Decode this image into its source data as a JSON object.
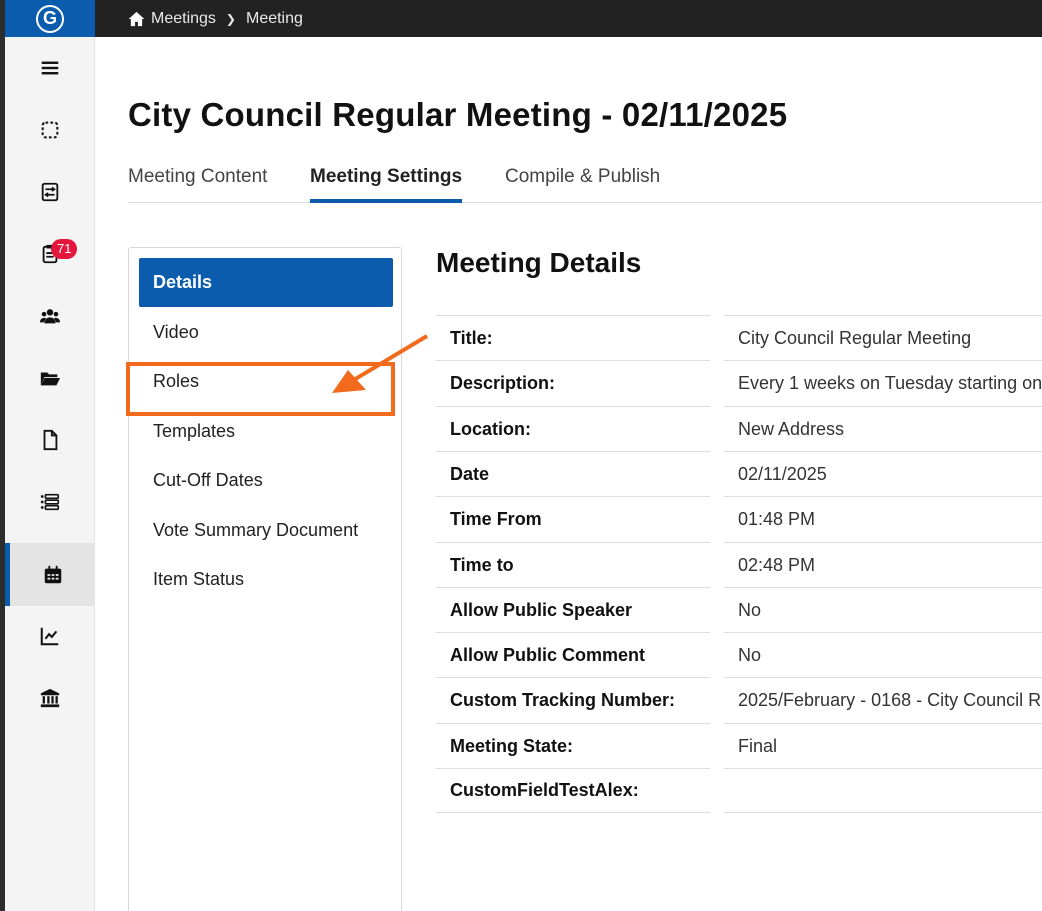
{
  "breadcrumb": {
    "items": [
      "Meetings",
      "Meeting"
    ]
  },
  "sidebar": {
    "icons": [
      "menu-icon",
      "select-area-icon",
      "agenda-icon",
      "tasks-icon",
      "users-icon",
      "folder-icon",
      "document-icon",
      "list-icon",
      "calendar-icon",
      "chart-icon",
      "government-icon"
    ],
    "badge": "71",
    "active": "calendar-icon"
  },
  "page": {
    "title": "City Council Regular Meeting - 02/11/2025"
  },
  "tabs": [
    {
      "label": "Meeting Content",
      "active": false
    },
    {
      "label": "Meeting Settings",
      "active": true
    },
    {
      "label": "Compile & Publish",
      "active": false
    }
  ],
  "settings_nav": {
    "items": [
      {
        "label": "Details",
        "active": true
      },
      {
        "label": "Video"
      },
      {
        "label": "Roles"
      },
      {
        "label": "Templates"
      },
      {
        "label": "Cut-Off Dates"
      },
      {
        "label": "Vote Summary Document"
      },
      {
        "label": "Item Status"
      }
    ]
  },
  "details": {
    "title": "Meeting Details",
    "rows": [
      {
        "label": "Title:",
        "value": "City Council Regular Meeting"
      },
      {
        "label": "Description:",
        "value": "Every 1 weeks on Tuesday starting on"
      },
      {
        "label": "Location:",
        "value": "New Address"
      },
      {
        "label": "Date",
        "value": "02/11/2025"
      },
      {
        "label": "Time From",
        "value": "01:48 PM"
      },
      {
        "label": "Time to",
        "value": "02:48 PM"
      },
      {
        "label": "Allow Public Speaker",
        "value": "No"
      },
      {
        "label": "Allow Public Comment",
        "value": "No"
      },
      {
        "label": "Custom Tracking Number:",
        "value": "2025/February - 0168 - City Council R"
      },
      {
        "label": "Meeting State:",
        "value": "Final"
      },
      {
        "label": "CustomFieldTestAlex:",
        "value": ""
      }
    ]
  },
  "colors": {
    "brand": "#0b5cad",
    "annotation": "#f26b1d",
    "badge": "#e3163d"
  }
}
